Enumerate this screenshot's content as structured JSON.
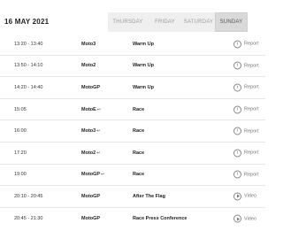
{
  "header": {
    "date": "16 MAY 2021",
    "days": [
      {
        "label": "THURSDAY",
        "active": false
      },
      {
        "label": "FRIDAY",
        "active": false
      },
      {
        "label": "SATURDAY",
        "active": false
      },
      {
        "label": "SUNDAY",
        "active": true
      }
    ]
  },
  "sessions": [
    {
      "time": "13:20 - 13:40",
      "class": "Moto3",
      "live_arrow": "",
      "event": "Warm Up",
      "action": "Report",
      "icon": "info-icon"
    },
    {
      "time": "13:50 - 14:10",
      "class": "Moto2",
      "live_arrow": "",
      "event": "Warm Up",
      "action": "Report",
      "icon": "info-icon"
    },
    {
      "time": "14:20 - 14:40",
      "class": "MotoGP",
      "live_arrow": "",
      "event": "Warm Up",
      "action": "Report",
      "icon": "info-icon"
    },
    {
      "time": "15:05",
      "class": "MotoE",
      "live_arrow": "↩",
      "event": "Race",
      "action": "Report",
      "icon": "info-icon"
    },
    {
      "time": "16:00",
      "class": "Moto3",
      "live_arrow": "↩",
      "event": "Race",
      "action": "Report",
      "icon": "info-icon"
    },
    {
      "time": "17:20",
      "class": "Moto2",
      "live_arrow": "↩",
      "event": "Race",
      "action": "Report",
      "icon": "info-icon"
    },
    {
      "time": "19:00",
      "class": "MotoGP",
      "live_arrow": "↩",
      "event": "Race",
      "action": "Report",
      "icon": "info-icon"
    },
    {
      "time": "20:10 - 20:45",
      "class": "MotoGP",
      "live_arrow": "",
      "event": "After The Flag",
      "action": "Video",
      "icon": "play-icon"
    },
    {
      "time": "20:45 - 21:30",
      "class": "MotoGP",
      "live_arrow": "",
      "event": "Race Press Conference",
      "action": "Video",
      "icon": "play-icon"
    }
  ]
}
